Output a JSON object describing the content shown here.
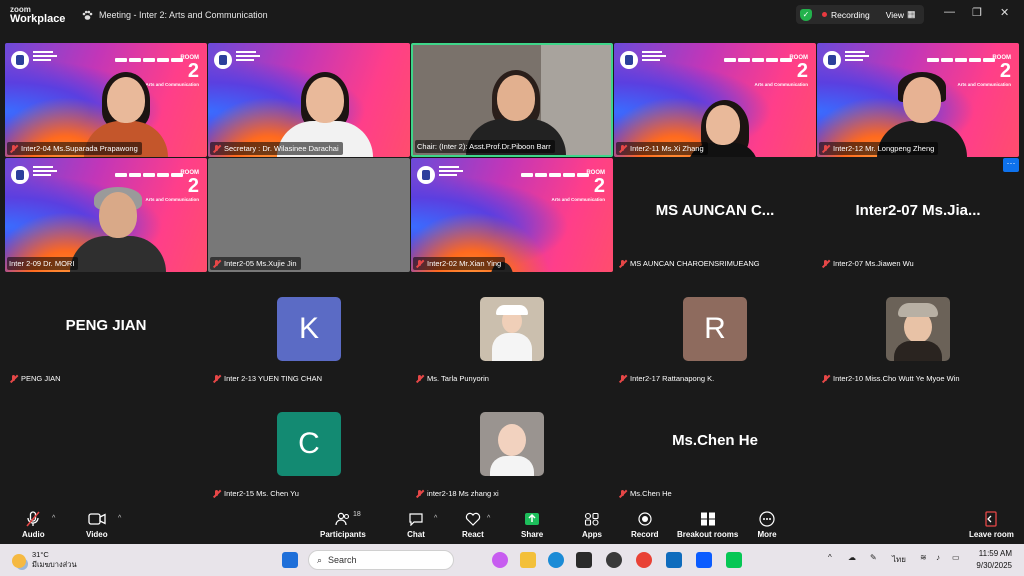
{
  "app": {
    "logo_line1": "zoom",
    "logo_line2": "Workplace",
    "meeting_title": "Meeting - Inter 2: Arts and Communication"
  },
  "status": {
    "recording": "Recording",
    "view": "View"
  },
  "conference_branding": {
    "room_word": "ROOM",
    "room_number": "2",
    "room_topic": "Arts and Communication"
  },
  "tiles": [
    {
      "name": "Inter2-04 Ms.Suparada Prapawong"
    },
    {
      "name": "Secretary : Dr. Wilasinee Darachai"
    },
    {
      "name": "Chair: (Inter 2): Asst.Prof.Dr.Piboon Barr"
    },
    {
      "name": "Inter2-11 Ms.Xi Zhang"
    },
    {
      "name": "Inter2-12 Mr. Longpeng Zheng"
    },
    {
      "name": "Inter 2-09 Dr. MORI"
    },
    {
      "name": "Inter2-05 Ms.Xujie Jin"
    },
    {
      "name": "Inter2-02 Mr.Xian Ying"
    },
    {
      "name": "MS AUNCAN CHAROENSRIMUEANG",
      "display": "MS  AUNCAN  C..."
    },
    {
      "name": "Inter2-07 Ms.Jiawen Wu",
      "display": "Inter2-07  Ms.Jia..."
    },
    {
      "name": "PENG JIAN",
      "display": "PENG JIAN"
    },
    {
      "name": "Inter 2-13 YUEN TING CHAN",
      "avatar": "K"
    },
    {
      "name": "Ms. Tarla Punyorin"
    },
    {
      "name": "Inter2-17 Rattanapong K.",
      "avatar": "R"
    },
    {
      "name": "Inter2-10 Miss.Cho Wutt Ye Myoe Win"
    },
    {
      "name": "Inter2-15 Ms. Chen Yu",
      "avatar": "C"
    },
    {
      "name": "inter2-18 Ms zhang xi"
    },
    {
      "name": "Ms.Chen He",
      "display": "Ms.Chen He"
    }
  ],
  "toolbar": {
    "audio": "Audio",
    "video": "Video",
    "participants": "Participants",
    "participants_count": "18",
    "chat": "Chat",
    "react": "React",
    "share": "Share",
    "apps": "Apps",
    "record": "Record",
    "breakout": "Breakout rooms",
    "more": "More",
    "leave": "Leave room"
  },
  "taskbar": {
    "temp": "31°C",
    "weather_desc": "มีเมฆบางส่วน",
    "search": "Search",
    "lang": "ไทย",
    "time": "11:59 AM",
    "date": "9/30/2025"
  },
  "colors": {
    "accent_green": "#3fd68a",
    "mic_red": "#e64747",
    "avatar_k": "#5b6bc5",
    "avatar_r": "#8e6b5e",
    "avatar_c": "#138a72"
  }
}
